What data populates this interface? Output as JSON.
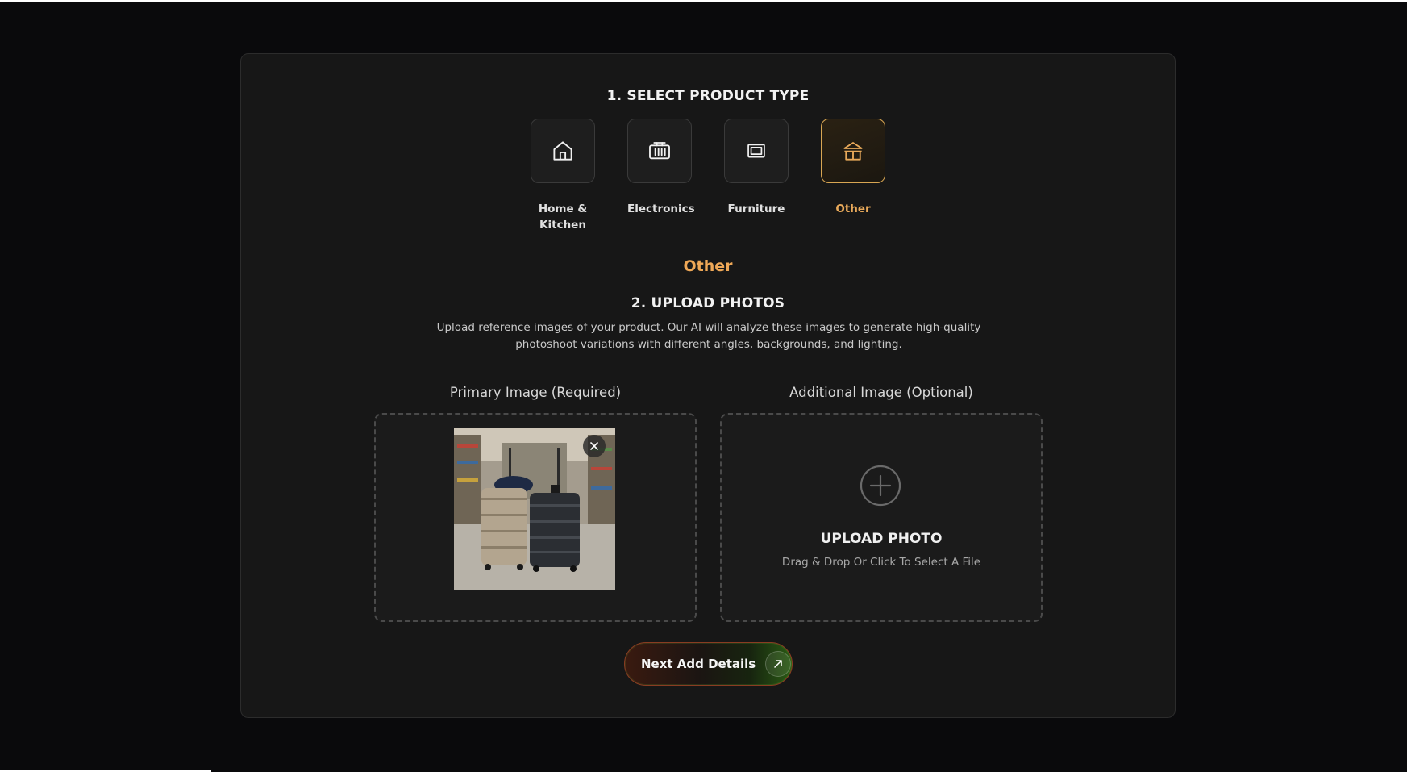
{
  "section1": {
    "title": "1. SELECT PRODUCT TYPE"
  },
  "product_types": [
    {
      "label": "Home & Kitchen",
      "icon": "house-icon",
      "selected": false
    },
    {
      "label": "Electronics",
      "icon": "radio-icon",
      "selected": false
    },
    {
      "label": "Furniture",
      "icon": "frame-icon",
      "selected": false
    },
    {
      "label": "Other",
      "icon": "store-icon",
      "selected": true
    }
  ],
  "selected_type": "Other",
  "section2": {
    "title": "2. UPLOAD PHOTOS",
    "description": "Upload reference images of your product. Our AI will analyze these images to generate high-quality photoshoot variations with different angles, backgrounds, and lighting."
  },
  "primary": {
    "label": "Primary Image (Required)"
  },
  "additional": {
    "label": "Additional Image (Optional)",
    "upload_title": "UPLOAD PHOTO",
    "upload_sub": "Drag & Drop Or Click To Select A File"
  },
  "next_button": {
    "label": "Next Add Details"
  },
  "colors": {
    "accent": "#efa857",
    "card_bg": "#171717",
    "page_bg": "#0a0a0c"
  }
}
